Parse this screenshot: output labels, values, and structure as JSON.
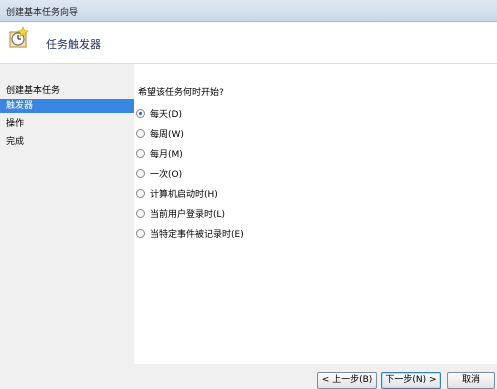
{
  "window": {
    "title": "创建基本任务向导"
  },
  "header": {
    "icon": "task-clock-icon",
    "heading": "任务触发器"
  },
  "steps": [
    {
      "label": "创建基本任务",
      "active": false
    },
    {
      "label": "触发器",
      "active": true
    },
    {
      "label": "操作",
      "active": false
    },
    {
      "label": "完成",
      "active": false
    }
  ],
  "main": {
    "question": "希望该任务何时开始?",
    "options": [
      {
        "label": "每天(D)",
        "checked": true
      },
      {
        "label": "每周(W)",
        "checked": false
      },
      {
        "label": "每月(M)",
        "checked": false
      },
      {
        "label": "一次(O)",
        "checked": false
      },
      {
        "label": "计算机启动时(H)",
        "checked": false
      },
      {
        "label": "当前用户登录时(L)",
        "checked": false
      },
      {
        "label": "当特定事件被记录时(E)",
        "checked": false
      }
    ]
  },
  "buttons": {
    "back": "< 上一步(B)",
    "next": "下一步(N) >",
    "cancel": "取消"
  },
  "colors": {
    "selection": "#3a86e0",
    "heading": "#1e2d5e"
  }
}
